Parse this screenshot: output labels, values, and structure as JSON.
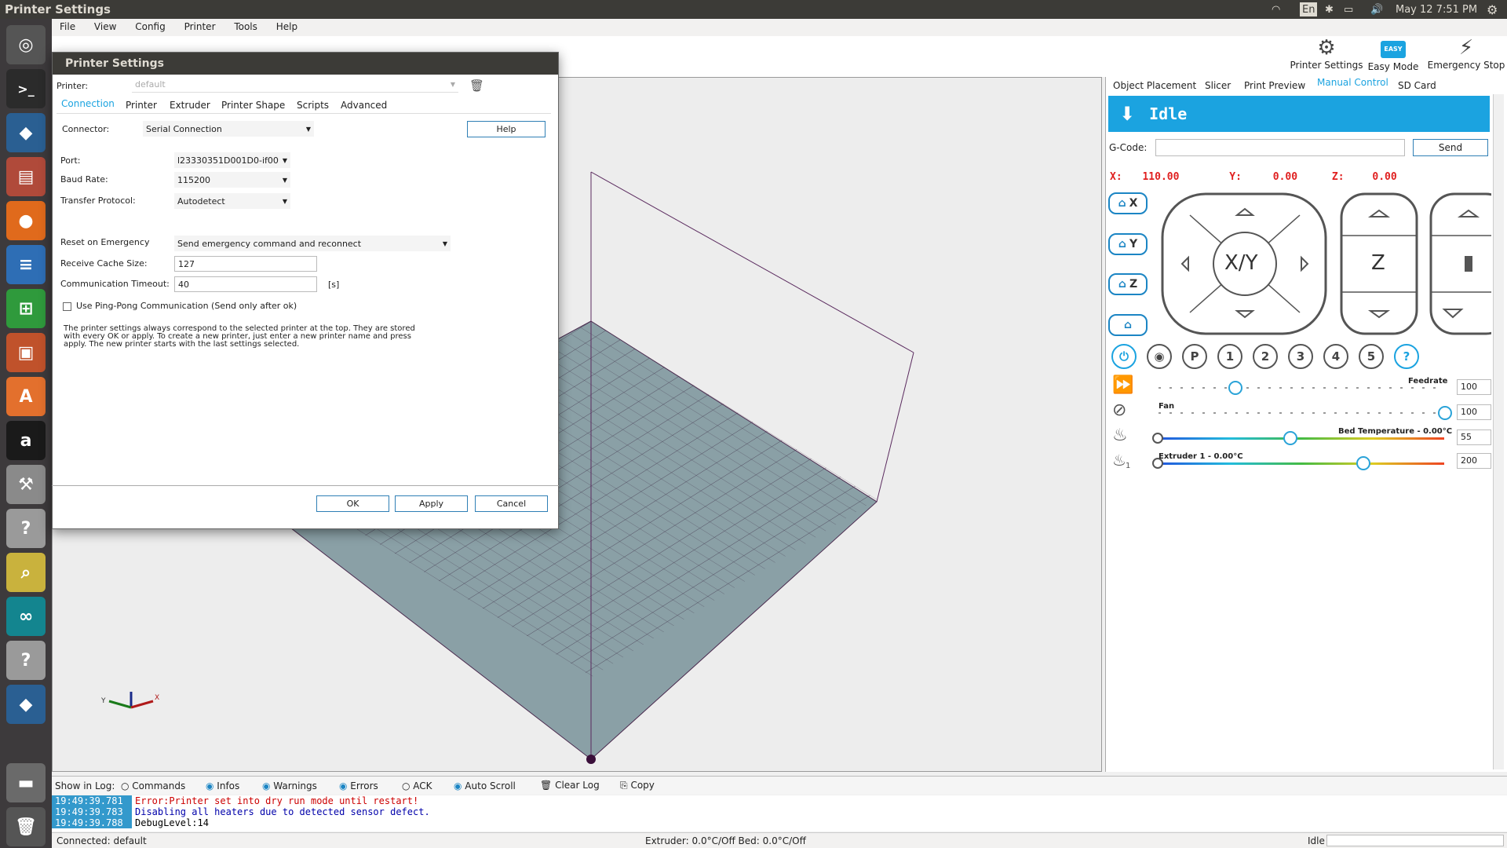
{
  "topbar": {
    "title": "Printer Settings",
    "lang": "En",
    "datetime": "May 12  7:51 PM"
  },
  "menu": [
    "File",
    "View",
    "Config",
    "Printer",
    "Tools",
    "Help"
  ],
  "toolbar": {
    "printer_settings": "Printer Settings",
    "easy_mode": "Easy Mode",
    "easy_badge": "EASY",
    "emergency_stop": "Emergency Stop"
  },
  "right_tabs": [
    "Object Placement",
    "Slicer",
    "Print Preview",
    "Manual Control",
    "SD Card"
  ],
  "manual": {
    "status": "Idle",
    "gcode_label": "G-Code:",
    "send": "Send",
    "coords": {
      "x_label": "X:",
      "x": "110.00",
      "y_label": "Y:",
      "y": "0.00",
      "z_label": "Z:",
      "z": "0.00"
    },
    "home": [
      "X",
      "Y",
      "Z",
      ""
    ],
    "xy": "X/Y",
    "z": "Z",
    "presets": [
      "P",
      "1",
      "2",
      "3",
      "4",
      "5",
      "?"
    ],
    "feedrate_label": "Feedrate",
    "feedrate": "100",
    "fan_label": "Fan",
    "fan": "100",
    "bed_label": "Bed Temperature - 0.00°C",
    "bed": "55",
    "extruder_label": "Extruder 1 - 0.00°C",
    "extruder": "200",
    "extruder_num": "1"
  },
  "dialog": {
    "title": "Printer Settings",
    "printer_label": "Printer:",
    "printer_value": "default",
    "tabs": [
      "Connection",
      "Printer",
      "Extruder",
      "Printer Shape",
      "Scripts",
      "Advanced"
    ],
    "connector_label": "Connector:",
    "connector_value": "Serial Connection",
    "help": "Help",
    "port_label": "Port:",
    "port_value": "l23330351D001D0-if00",
    "baud_label": "Baud Rate:",
    "baud_value": "115200",
    "protocol_label": "Transfer Protocol:",
    "protocol_value": "Autodetect",
    "reset_label": "Reset on Emergency",
    "reset_value": "Send emergency command and reconnect",
    "cache_label": "Receive Cache Size:",
    "cache_value": "127",
    "timeout_label": "Communication Timeout:",
    "timeout_value": "40",
    "timeout_unit": "[s]",
    "pingpong_label": "Use Ping-Pong Communication (Send only after ok)",
    "info": "The printer settings always correspond to the selected printer at the top. They are stored with every OK or apply. To create a new printer, just enter a new printer name and press apply. The new printer starts with the last settings selected.",
    "ok": "OK",
    "apply": "Apply",
    "cancel": "Cancel"
  },
  "log": {
    "show_label": "Show in Log:",
    "filters": [
      "Commands",
      "Infos",
      "Warnings",
      "Errors",
      "ACK",
      "Auto Scroll"
    ],
    "clear": "Clear Log",
    "copy": "Copy",
    "lines": [
      {
        "ts": "19:49:39.781",
        "msg": "Error:Printer set into dry run mode until restart!",
        "color": "#cc0000"
      },
      {
        "ts": "19:49:39.783",
        "msg": "Disabling all heaters due to detected sensor defect.",
        "color": "#0000aa"
      },
      {
        "ts": "19:49:39.788",
        "msg": "DebugLevel:14",
        "color": "#000000"
      }
    ]
  },
  "status": {
    "connected": "Connected: default",
    "temps": "Extruder: 0.0°C/Off Bed: 0.0°C/Off",
    "state": "Idle"
  }
}
